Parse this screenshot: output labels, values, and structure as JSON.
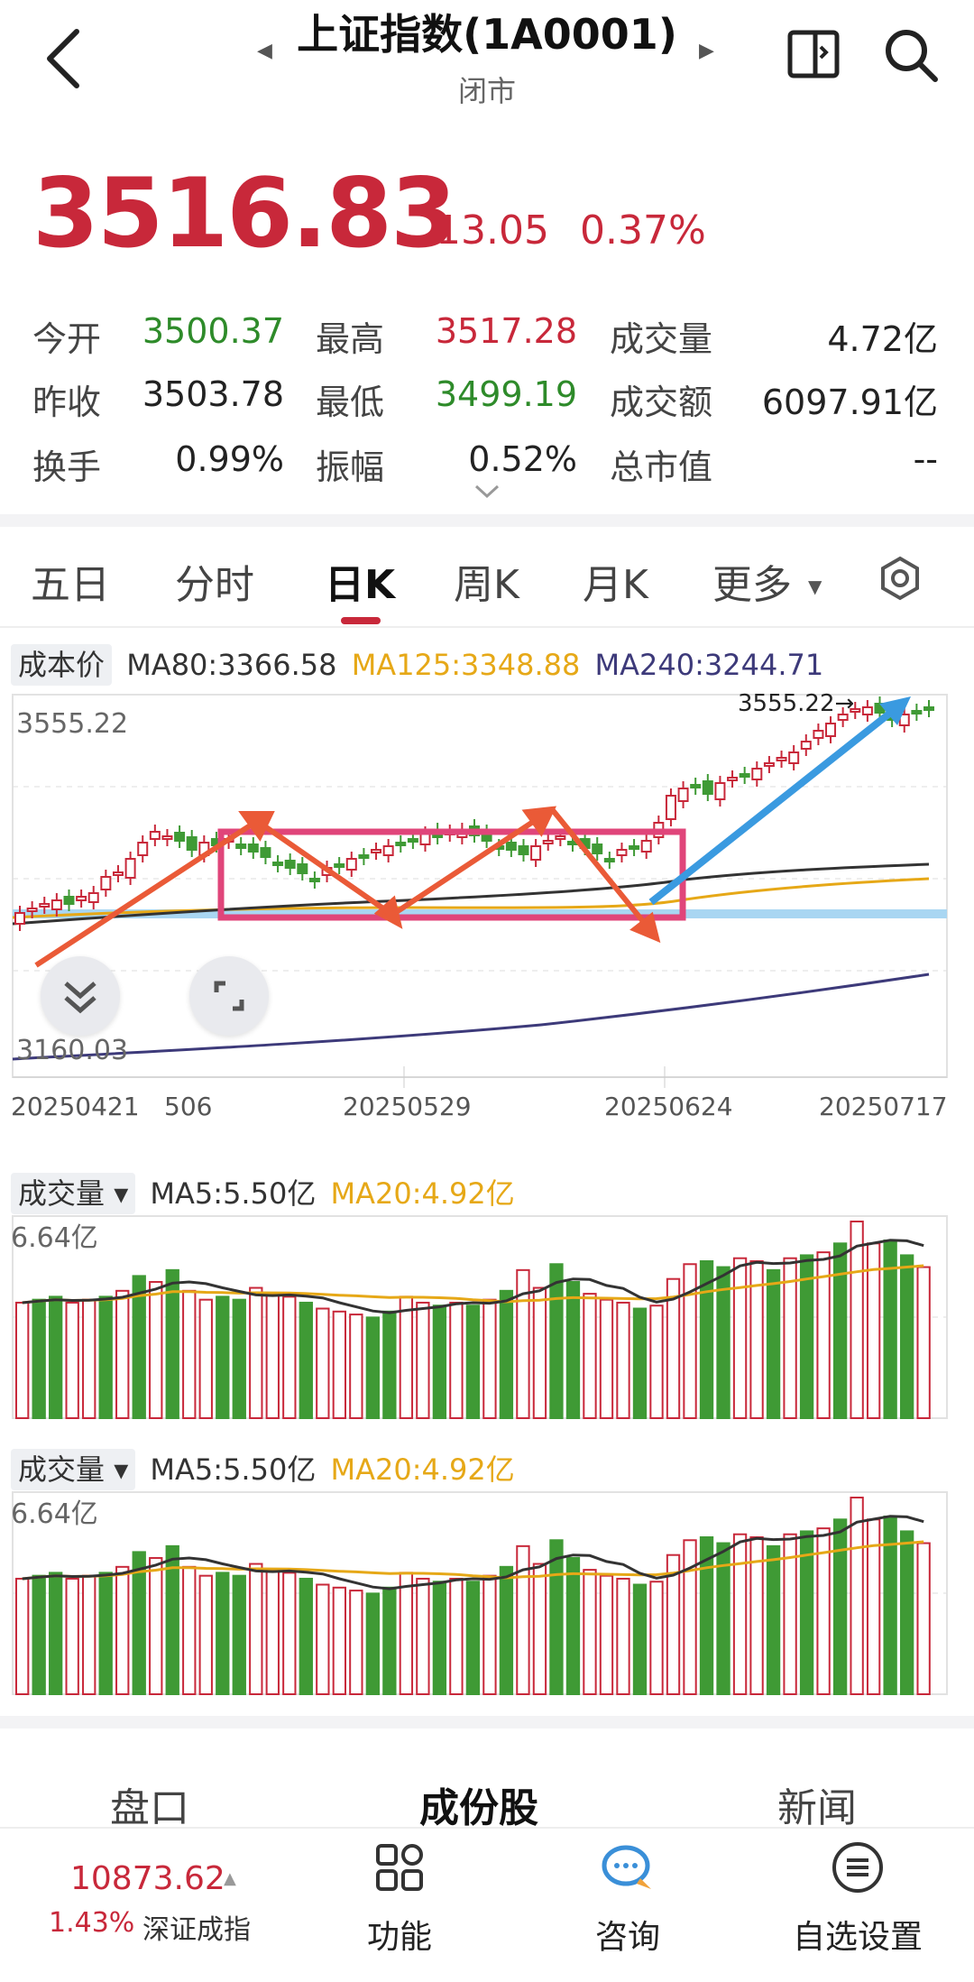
{
  "header": {
    "title": "上证指数(1A0001)",
    "status": "闭市"
  },
  "quote": {
    "price": "3516.83",
    "change": "13.05",
    "change_pct": "0.37%",
    "stats": [
      {
        "label": "今开",
        "value": "3500.37",
        "color": "green"
      },
      {
        "label": "最高",
        "value": "3517.28",
        "color": "red"
      },
      {
        "label": "成交量",
        "value": "4.72亿",
        "color": "dark"
      },
      {
        "label": "昨收",
        "value": "3503.78",
        "color": "dark"
      },
      {
        "label": "最低",
        "value": "3499.19",
        "color": "green"
      },
      {
        "label": "成交额",
        "value": "6097.91亿",
        "color": "dark"
      },
      {
        "label": "换手",
        "value": "0.99%",
        "color": "dark"
      },
      {
        "label": "振幅",
        "value": "0.52%",
        "color": "dark"
      },
      {
        "label": "总市值",
        "value": "--",
        "color": "dark"
      }
    ]
  },
  "tabs": [
    "五日",
    "分时",
    "日K",
    "周K",
    "月K",
    "更多"
  ],
  "active_tab": "日K",
  "kline": {
    "legend_chip": "成本价",
    "ma80": "MA80:3366.58",
    "ma125": "MA125:3348.88",
    "ma240": "MA240:3244.71",
    "y_high": "3555.22",
    "y_low": "3160.03",
    "peak_label": "3555.22→",
    "dates": [
      "20250421",
      "506",
      "20250529",
      "20250624",
      "20250717"
    ]
  },
  "volume_panels": [
    {
      "chip": "成交量",
      "ma5": "MA5:5.50亿",
      "ma20": "MA20:4.92亿",
      "y_high": "6.64亿"
    },
    {
      "chip": "成交量",
      "ma5": "MA5:5.50亿",
      "ma20": "MA20:4.92亿",
      "y_high": "6.64亿"
    }
  ],
  "chart_data": {
    "type": "bar",
    "title": "",
    "series": [
      {
        "name": "成交量",
        "values": [
          3.9,
          4.0,
          4.1,
          3.9,
          4.0,
          4.1,
          4.3,
          4.8,
          4.6,
          5.0,
          4.3,
          4.0,
          4.1,
          4.0,
          4.4,
          4.2,
          4.1,
          3.9,
          3.7,
          3.6,
          3.5,
          3.4,
          3.6,
          4.1,
          3.9,
          3.8,
          3.9,
          3.8,
          4.0,
          4.3,
          5.0,
          4.4,
          5.2,
          4.6,
          4.2,
          4.0,
          3.9,
          3.7,
          3.8,
          4.7,
          5.2,
          5.3,
          5.1,
          5.4,
          5.3,
          5.0,
          5.4,
          5.5,
          5.6,
          5.9,
          6.64,
          5.9,
          6.0,
          5.5,
          5.1
        ]
      }
    ],
    "ylim": [
      0,
      6.64
    ],
    "colors": {
      "up": "#c8283a",
      "down": "#3f9a35",
      "ma5": "#333333",
      "ma20": "#e6a817"
    }
  },
  "bottom_tabs": [
    "盘口",
    "成份股",
    "新闻"
  ],
  "active_bottom_tab": "成份股",
  "bottom_bar": {
    "index_value": "10873.62",
    "index_pct": "1.43%",
    "index_name": "深证成指",
    "buttons": [
      "功能",
      "咨询",
      "自选设置"
    ]
  }
}
